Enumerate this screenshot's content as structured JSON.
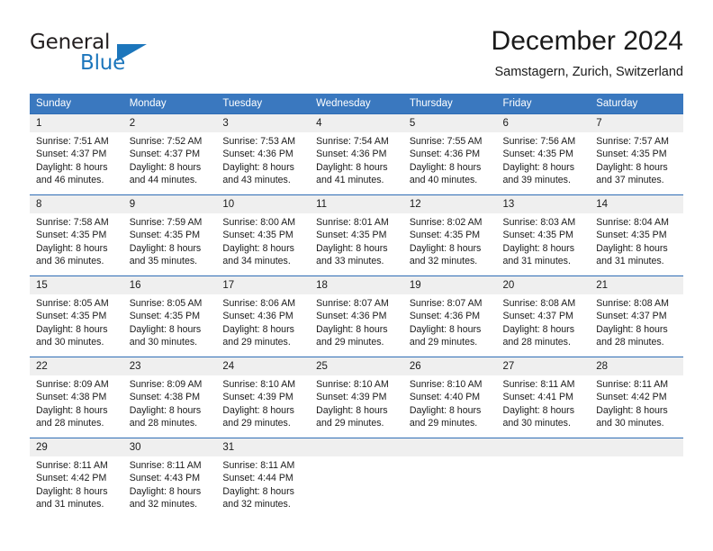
{
  "brand": {
    "name_part1": "General",
    "name_part2": "Blue",
    "logo_icon": "triangle-flag-icon"
  },
  "header": {
    "month_title": "December 2024",
    "location": "Samstagern, Zurich, Switzerland"
  },
  "calendar": {
    "weekday_headers": [
      "Sunday",
      "Monday",
      "Tuesday",
      "Wednesday",
      "Thursday",
      "Friday",
      "Saturday"
    ],
    "accent_color": "#3a78bf",
    "border_color": "#2f6db5",
    "daynum_background": "#efefef",
    "weeks": [
      [
        {
          "day": "1",
          "sunrise": "Sunrise: 7:51 AM",
          "sunset": "Sunset: 4:37 PM",
          "daylight": "Daylight: 8 hours and 46 minutes."
        },
        {
          "day": "2",
          "sunrise": "Sunrise: 7:52 AM",
          "sunset": "Sunset: 4:37 PM",
          "daylight": "Daylight: 8 hours and 44 minutes."
        },
        {
          "day": "3",
          "sunrise": "Sunrise: 7:53 AM",
          "sunset": "Sunset: 4:36 PM",
          "daylight": "Daylight: 8 hours and 43 minutes."
        },
        {
          "day": "4",
          "sunrise": "Sunrise: 7:54 AM",
          "sunset": "Sunset: 4:36 PM",
          "daylight": "Daylight: 8 hours and 41 minutes."
        },
        {
          "day": "5",
          "sunrise": "Sunrise: 7:55 AM",
          "sunset": "Sunset: 4:36 PM",
          "daylight": "Daylight: 8 hours and 40 minutes."
        },
        {
          "day": "6",
          "sunrise": "Sunrise: 7:56 AM",
          "sunset": "Sunset: 4:35 PM",
          "daylight": "Daylight: 8 hours and 39 minutes."
        },
        {
          "day": "7",
          "sunrise": "Sunrise: 7:57 AM",
          "sunset": "Sunset: 4:35 PM",
          "daylight": "Daylight: 8 hours and 37 minutes."
        }
      ],
      [
        {
          "day": "8",
          "sunrise": "Sunrise: 7:58 AM",
          "sunset": "Sunset: 4:35 PM",
          "daylight": "Daylight: 8 hours and 36 minutes."
        },
        {
          "day": "9",
          "sunrise": "Sunrise: 7:59 AM",
          "sunset": "Sunset: 4:35 PM",
          "daylight": "Daylight: 8 hours and 35 minutes."
        },
        {
          "day": "10",
          "sunrise": "Sunrise: 8:00 AM",
          "sunset": "Sunset: 4:35 PM",
          "daylight": "Daylight: 8 hours and 34 minutes."
        },
        {
          "day": "11",
          "sunrise": "Sunrise: 8:01 AM",
          "sunset": "Sunset: 4:35 PM",
          "daylight": "Daylight: 8 hours and 33 minutes."
        },
        {
          "day": "12",
          "sunrise": "Sunrise: 8:02 AM",
          "sunset": "Sunset: 4:35 PM",
          "daylight": "Daylight: 8 hours and 32 minutes."
        },
        {
          "day": "13",
          "sunrise": "Sunrise: 8:03 AM",
          "sunset": "Sunset: 4:35 PM",
          "daylight": "Daylight: 8 hours and 31 minutes."
        },
        {
          "day": "14",
          "sunrise": "Sunrise: 8:04 AM",
          "sunset": "Sunset: 4:35 PM",
          "daylight": "Daylight: 8 hours and 31 minutes."
        }
      ],
      [
        {
          "day": "15",
          "sunrise": "Sunrise: 8:05 AM",
          "sunset": "Sunset: 4:35 PM",
          "daylight": "Daylight: 8 hours and 30 minutes."
        },
        {
          "day": "16",
          "sunrise": "Sunrise: 8:05 AM",
          "sunset": "Sunset: 4:35 PM",
          "daylight": "Daylight: 8 hours and 30 minutes."
        },
        {
          "day": "17",
          "sunrise": "Sunrise: 8:06 AM",
          "sunset": "Sunset: 4:36 PM",
          "daylight": "Daylight: 8 hours and 29 minutes."
        },
        {
          "day": "18",
          "sunrise": "Sunrise: 8:07 AM",
          "sunset": "Sunset: 4:36 PM",
          "daylight": "Daylight: 8 hours and 29 minutes."
        },
        {
          "day": "19",
          "sunrise": "Sunrise: 8:07 AM",
          "sunset": "Sunset: 4:36 PM",
          "daylight": "Daylight: 8 hours and 29 minutes."
        },
        {
          "day": "20",
          "sunrise": "Sunrise: 8:08 AM",
          "sunset": "Sunset: 4:37 PM",
          "daylight": "Daylight: 8 hours and 28 minutes."
        },
        {
          "day": "21",
          "sunrise": "Sunrise: 8:08 AM",
          "sunset": "Sunset: 4:37 PM",
          "daylight": "Daylight: 8 hours and 28 minutes."
        }
      ],
      [
        {
          "day": "22",
          "sunrise": "Sunrise: 8:09 AM",
          "sunset": "Sunset: 4:38 PM",
          "daylight": "Daylight: 8 hours and 28 minutes."
        },
        {
          "day": "23",
          "sunrise": "Sunrise: 8:09 AM",
          "sunset": "Sunset: 4:38 PM",
          "daylight": "Daylight: 8 hours and 28 minutes."
        },
        {
          "day": "24",
          "sunrise": "Sunrise: 8:10 AM",
          "sunset": "Sunset: 4:39 PM",
          "daylight": "Daylight: 8 hours and 29 minutes."
        },
        {
          "day": "25",
          "sunrise": "Sunrise: 8:10 AM",
          "sunset": "Sunset: 4:39 PM",
          "daylight": "Daylight: 8 hours and 29 minutes."
        },
        {
          "day": "26",
          "sunrise": "Sunrise: 8:10 AM",
          "sunset": "Sunset: 4:40 PM",
          "daylight": "Daylight: 8 hours and 29 minutes."
        },
        {
          "day": "27",
          "sunrise": "Sunrise: 8:11 AM",
          "sunset": "Sunset: 4:41 PM",
          "daylight": "Daylight: 8 hours and 30 minutes."
        },
        {
          "day": "28",
          "sunrise": "Sunrise: 8:11 AM",
          "sunset": "Sunset: 4:42 PM",
          "daylight": "Daylight: 8 hours and 30 minutes."
        }
      ],
      [
        {
          "day": "29",
          "sunrise": "Sunrise: 8:11 AM",
          "sunset": "Sunset: 4:42 PM",
          "daylight": "Daylight: 8 hours and 31 minutes."
        },
        {
          "day": "30",
          "sunrise": "Sunrise: 8:11 AM",
          "sunset": "Sunset: 4:43 PM",
          "daylight": "Daylight: 8 hours and 32 minutes."
        },
        {
          "day": "31",
          "sunrise": "Sunrise: 8:11 AM",
          "sunset": "Sunset: 4:44 PM",
          "daylight": "Daylight: 8 hours and 32 minutes."
        },
        {
          "day": "",
          "sunrise": "",
          "sunset": "",
          "daylight": ""
        },
        {
          "day": "",
          "sunrise": "",
          "sunset": "",
          "daylight": ""
        },
        {
          "day": "",
          "sunrise": "",
          "sunset": "",
          "daylight": ""
        },
        {
          "day": "",
          "sunrise": "",
          "sunset": "",
          "daylight": ""
        }
      ]
    ]
  }
}
